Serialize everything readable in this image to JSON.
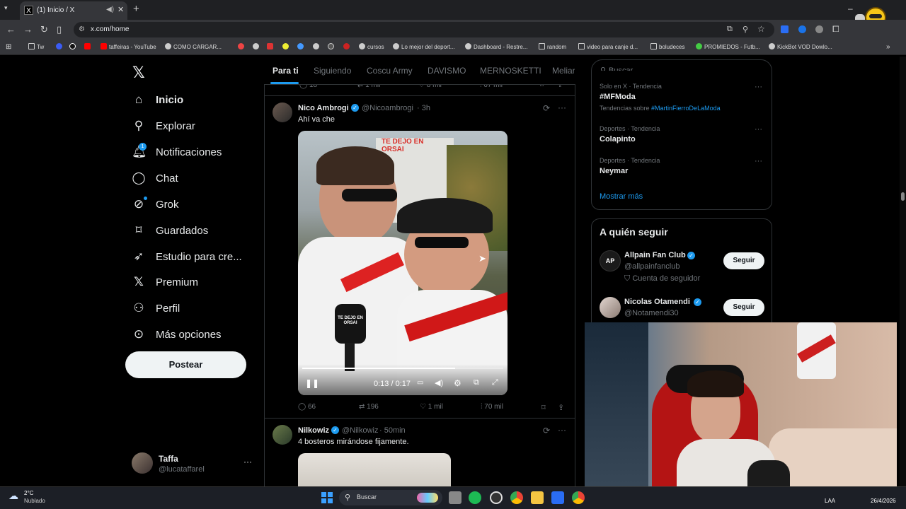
{
  "browser": {
    "tab_title": "(1) Inicio / X",
    "tab_favicon": "X",
    "url": "x.com/home",
    "bookmarks": [
      "Tw",
      "",
      "",
      "taffeiras - YouTube",
      "COMO CARGAR...",
      "",
      "",
      "",
      "",
      "",
      "",
      "cursos",
      "Lo mejor del deport...",
      "Dashboard - Restre...",
      "random",
      "video para canje d...",
      "boludeces",
      "PROMIEDOS - Futb...",
      "KickBot VOD Dowlo..."
    ]
  },
  "nav": {
    "items": [
      {
        "label": "Inicio",
        "icon": "home-icon"
      },
      {
        "label": "Explorar",
        "icon": "search-icon"
      },
      {
        "label": "Notificaciones",
        "icon": "bell-icon",
        "badge": "1"
      },
      {
        "label": "Chat",
        "icon": "chat-icon"
      },
      {
        "label": "Grok",
        "icon": "grok-icon"
      },
      {
        "label": "Guardados",
        "icon": "bookmark-icon"
      },
      {
        "label": "Estudio para cre...",
        "icon": "rocket-icon"
      },
      {
        "label": "Premium",
        "icon": "x-logo-icon"
      },
      {
        "label": "Perfil",
        "icon": "person-icon"
      },
      {
        "label": "Más opciones",
        "icon": "more-circle-icon"
      }
    ],
    "post_button": "Postear",
    "account": {
      "name": "Taffa",
      "handle": "@lucataffarel"
    }
  },
  "feed": {
    "tabs": [
      "Para ti",
      "Siguiendo",
      "Coscu Army",
      "DAVISMO",
      "MERNOSKETTI",
      "Meliar"
    ],
    "prev_actions": {
      "replies": "18",
      "reposts": "1 mil",
      "likes": "8 mil",
      "views": "67 mil"
    },
    "post1": {
      "name": "Nico Ambrogi",
      "handle": "@Nicoambrogi",
      "time": "· 3h",
      "text": "Ahí va che",
      "video_time": "0:13 / 0:17",
      "video_progress": 0.76,
      "video_overlay_text": "TE DEJO EN ORSAI",
      "mic_text": "TE DEJO EN ORSAI",
      "actions": {
        "replies": "66",
        "reposts": "196",
        "likes": "1 mil",
        "views": "70 mil"
      }
    },
    "post2": {
      "name": "Nilkowiz",
      "handle": "@Nilkowiz",
      "time": "· 50min",
      "text": "4 bosteros mirándose fijamente."
    }
  },
  "sidebar": {
    "search_placeholder": "Buscar",
    "trends": [
      {
        "meta": "Solo en X · Tendencia",
        "name": "#MFModa",
        "sub_prefix": "Tendencias sobre ",
        "sub_link": "#MartinFierroDeLaModa"
      },
      {
        "meta": "Deportes · Tendencia",
        "name": "Colapinto"
      },
      {
        "meta": "Deportes · Tendencia",
        "name": "Neymar"
      }
    ],
    "show_more": "Mostrar más",
    "who_to_follow_title": "A quién seguir",
    "follows": [
      {
        "name": "Allpain Fan Club",
        "handle": "@allpainfanclub",
        "extra": "Cuenta de seguidor",
        "button": "Seguir",
        "avatar_text": "AP"
      },
      {
        "name": "Nicolas Otamendi",
        "handle": "@Notamendi30",
        "button": "Seguir"
      }
    ]
  },
  "taskbar": {
    "weather_temp": "2°C",
    "weather_desc": "Nublado",
    "search": "Buscar",
    "lang": "LAA",
    "date": "26/4/2026"
  },
  "colors": {
    "accent": "#1d9bf0",
    "background": "#000000",
    "muted": "#71767b"
  }
}
